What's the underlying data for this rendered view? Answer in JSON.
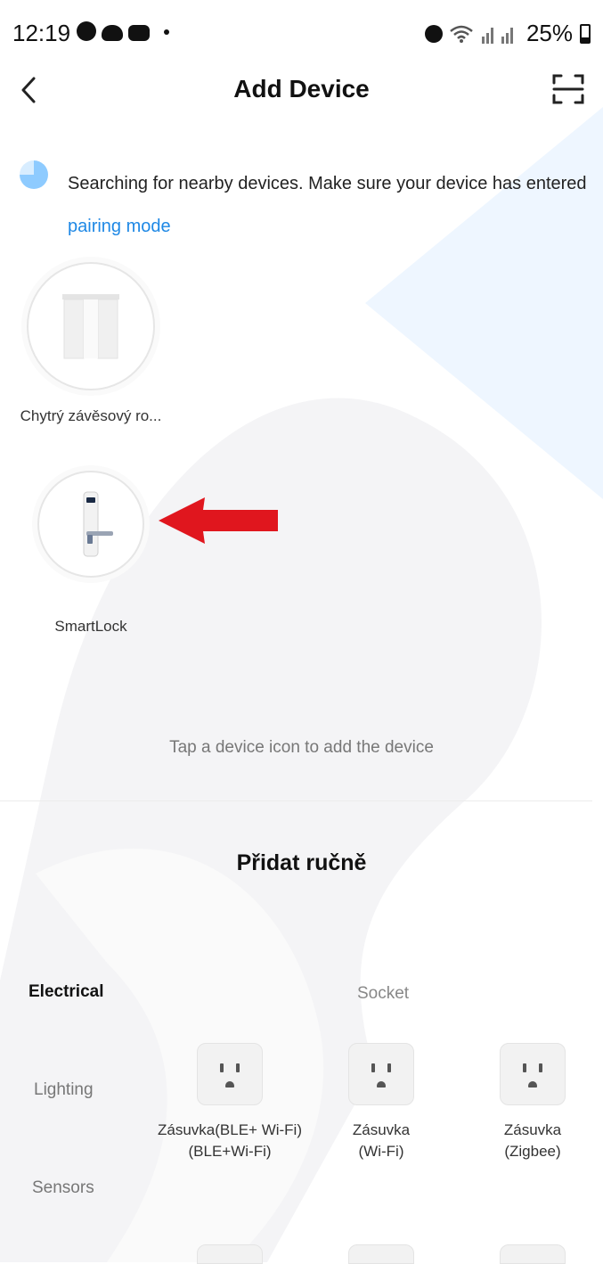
{
  "status_bar": {
    "time": "12:19",
    "battery_text": "25%",
    "icons": [
      "messenger-icon",
      "cloud-icon",
      "game-icon",
      "alarm-icon",
      "wifi-icon",
      "signal-icon",
      "battery-icon"
    ]
  },
  "header": {
    "title": "Add Device",
    "back_icon": "chevron-left-icon",
    "scan_icon": "scan-icon"
  },
  "search": {
    "text": "Searching for nearby devices. Make sure your device has entered ",
    "link": "pairing mode"
  },
  "discovered_devices": [
    {
      "label": "Chytrý závěsový ro...",
      "icon": "curtain-icon"
    },
    {
      "label": "SmartLock",
      "icon": "smart-lock-icon"
    }
  ],
  "tap_hint": "Tap a device icon to add the device",
  "manual_section": {
    "title": "Přidat ručně",
    "categories": [
      "Electrical",
      "Lighting",
      "Sensors"
    ],
    "active_category": "Electrical",
    "section_title": "Socket",
    "items": [
      {
        "label": "Zásuvka(BLE+ Wi-Fi) (BLE+Wi-Fi)",
        "icon": "socket-icon"
      },
      {
        "label": "Zásuvka (Wi-Fi)",
        "icon": "socket-icon"
      },
      {
        "label": "Zásuvka (Zigbee)",
        "icon": "socket-icon"
      }
    ]
  },
  "colors": {
    "accent": "#1e88e5",
    "arrow": "#e0161e",
    "watermark": "#e8f3ff"
  }
}
